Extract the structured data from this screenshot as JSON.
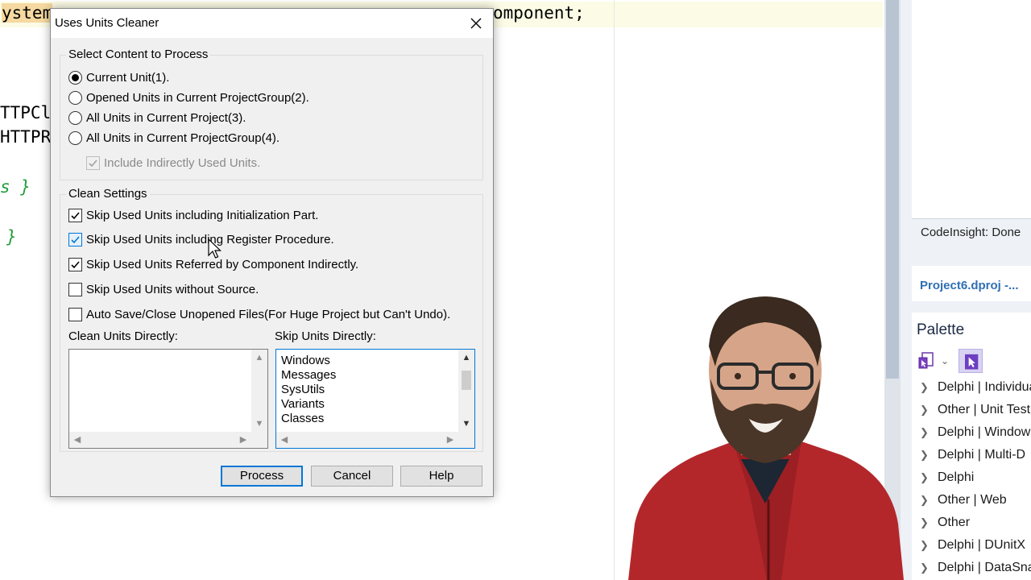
{
  "editor": {
    "lines": [
      {
        "before": "ystem",
        "highlight": "",
        "after": "",
        "trailing": "omponent;"
      },
      {
        "text": "TTPCl"
      },
      {
        "text": "HTTPR"
      },
      {
        "text": "} "
      },
      {
        "text": "}"
      }
    ],
    "green_line_1": "s }",
    "green_line_2": "}"
  },
  "dialog": {
    "title": "Uses Units Cleaner",
    "content_group": {
      "label": "Select Content to Process",
      "options": [
        {
          "label": "Current Unit(1).",
          "selected": true
        },
        {
          "label": "Opened Units in Current ProjectGroup(2).",
          "selected": false
        },
        {
          "label": "All Units in Current Project(3).",
          "selected": false
        },
        {
          "label": "All Units in Current ProjectGroup(4).",
          "selected": false
        }
      ],
      "include_indirect": {
        "label": "Include Indirectly Used Units.",
        "checked": true,
        "enabled": false
      }
    },
    "clean_group": {
      "label": "Clean Settings",
      "options": [
        {
          "label": "Skip Used Units including Initialization Part.",
          "checked": true
        },
        {
          "label": "Skip Used Units including Register Procedure.",
          "checked": true
        },
        {
          "label": "Skip Used Units Referred by Component Indirectly.",
          "checked": true
        },
        {
          "label": "Skip Used Units without Source.",
          "checked": false
        },
        {
          "label": "Auto Save/Close Unopened Files(For Huge Project but Can't Undo).",
          "checked": false
        }
      ]
    },
    "clean_units_label": "Clean Units Directly:",
    "skip_units_label": "Skip Units Directly:",
    "clean_units": [],
    "skip_units": [
      "Windows",
      "Messages",
      "SysUtils",
      "Variants",
      "Classes"
    ],
    "buttons": {
      "process": "Process",
      "cancel": "Cancel",
      "help": "Help"
    }
  },
  "right_panel": {
    "status": "CodeInsight: Done",
    "project": "Project6.dproj -...",
    "palette_title": "Palette",
    "palette_items": [
      "Delphi | Individual",
      "Other | Unit Test",
      "Delphi | Windows",
      "Delphi | Multi-D",
      "Delphi",
      "Other | Web",
      "Other",
      "Delphi | DUnitX",
      "Delphi | DataSnap"
    ]
  },
  "colors": {
    "accent": "#0078d7",
    "project_link": "#2f6fb5",
    "code_green": "#1f9e3a",
    "highlight": "#f5d9a0"
  }
}
